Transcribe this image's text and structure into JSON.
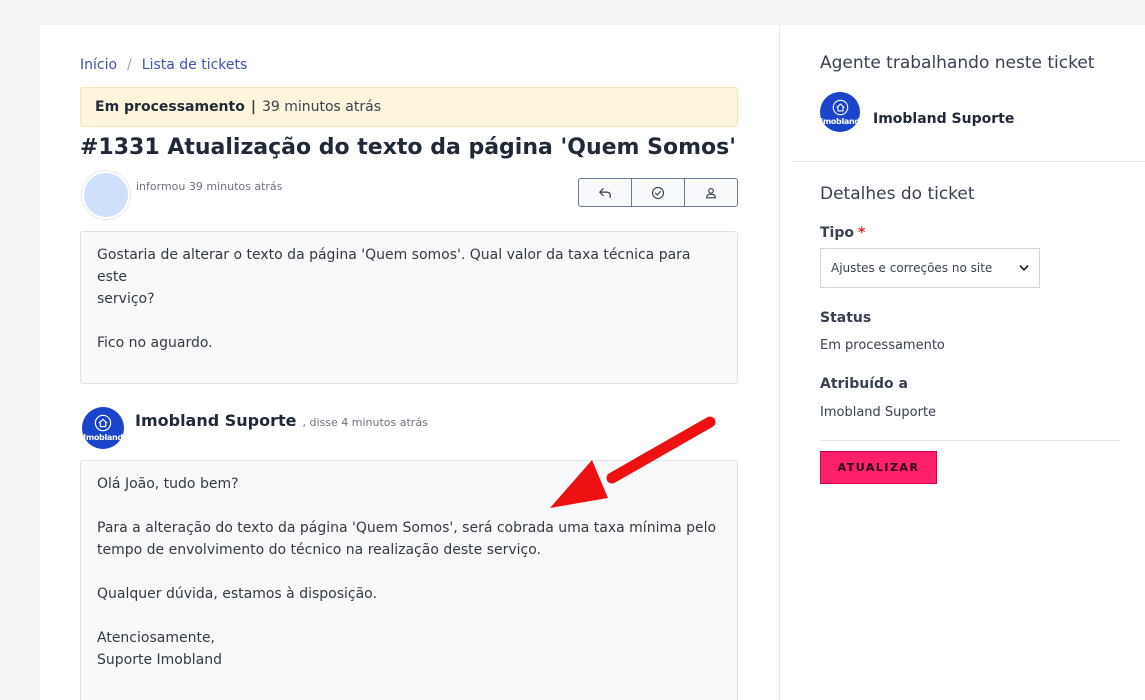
{
  "breadcrumb": {
    "home": "Início",
    "separator": "/",
    "tickets": "Lista de tickets"
  },
  "status_banner": {
    "status": "Em processamento",
    "divider": "|",
    "time": "39 minutos atrás"
  },
  "ticket": {
    "title": "#1331 Atualização do texto da página 'Quem Somos'"
  },
  "first_post": {
    "meta": "informou 39 minutos atrás",
    "lines": [
      "Gostaria de alterar o texto da página 'Quem somos'. Qual  valor da taxa técnica para este",
      "serviço?",
      "Fico no aguardo."
    ]
  },
  "actions": {
    "reply_icon": "reply-icon",
    "resolve_icon": "check-circle-icon",
    "assign_icon": "user-icon"
  },
  "reply": {
    "author": "Imobland Suporte",
    "meta": ", disse 4 minutos atrás",
    "logo_text": "Imobland",
    "lines": [
      "Olá João, tudo bem?",
      "Para a alteração do texto da página 'Quem Somos', será cobrada uma taxa mínima pelo",
      "tempo de envolvimento do técnico na realização deste serviço.",
      "Qualquer dúvida, estamos à disposição.",
      "Atenciosamente,",
      "Suporte Imobland"
    ]
  },
  "sidebar": {
    "agent_heading": "Agente trabalhando neste ticket",
    "agent_name": "Imobland Suporte",
    "agent_logo_text": "Imobland",
    "details_heading": "Detalhes do ticket",
    "type_label": "Tipo",
    "type_required": "*",
    "type_value": "Ajustes e correções no site",
    "status_label": "Status",
    "status_value": "Em processamento",
    "assigned_label": "Atribuído a",
    "assigned_value": "Imobland Suporte",
    "update_button": "ATUALIZAR"
  },
  "colors": {
    "accent": "#ff1f6b",
    "link": "#3f51b5",
    "banner": "#fdf6dc",
    "logo": "#1a44c9",
    "arrow": "#ee1111"
  }
}
